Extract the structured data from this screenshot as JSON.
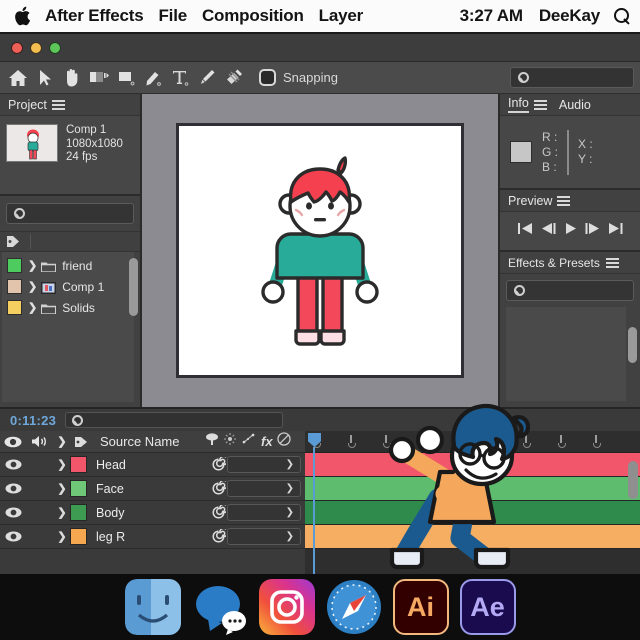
{
  "menubar": {
    "apple_icon": "apple-logo",
    "items": [
      "After Effects",
      "File",
      "Composition",
      "Layer"
    ],
    "time": "3:27 AM",
    "user": "DeeKay",
    "search_icon": "search-icon"
  },
  "window": {
    "controls": [
      "close-button",
      "minimize-button",
      "maximize-button"
    ]
  },
  "toolbar": {
    "tools": [
      "home-icon",
      "selection-arrow-icon",
      "hand-icon",
      "rotation-icon",
      "shape-icon",
      "pen-icon",
      "text-icon",
      "brush-icon",
      "clone-stamp-icon"
    ],
    "snapping_label": "Snapping",
    "snapping_checked": false,
    "search_placeholder": ""
  },
  "project_panel": {
    "title": "Project",
    "menu_icon": "hamburger-icon",
    "comp": {
      "name": "Comp 1",
      "resolution": "1080x1080",
      "framerate": "24 fps"
    },
    "search_placeholder": "",
    "label_column_icon": "tag-icon",
    "assets": [
      {
        "name": "friend",
        "color": "#4ecb5e",
        "type": "folder"
      },
      {
        "name": "Comp 1",
        "color": "#e2c3ac",
        "type": "composition"
      },
      {
        "name": "Solids",
        "color": "#f5cf5f",
        "type": "folder"
      }
    ]
  },
  "comp_viewer": {
    "background": "#8b8b91",
    "canvas_background": "#ffffff",
    "character": {
      "hair": "#f5404f",
      "skin": "#ffffff",
      "sweater": "#29ab9a",
      "pants": "#f2485a",
      "shoes": "#fbdfe4",
      "outline": "#2b2b2b"
    }
  },
  "info_panel": {
    "title": "Info",
    "menu_icon": "hamburger-icon",
    "audio_tab": "Audio",
    "channels": [
      "R :",
      "G :",
      "B :"
    ],
    "coords": [
      "X :",
      "Y :"
    ]
  },
  "preview_panel": {
    "title": "Preview",
    "menu_icon": "hamburger-icon",
    "buttons": [
      "first-frame-button",
      "previous-frame-button",
      "play-button",
      "next-frame-button",
      "last-frame-button"
    ]
  },
  "effects_panel": {
    "title": "Effects & Presets",
    "menu_icon": "hamburger-icon",
    "search_placeholder": ""
  },
  "timeline": {
    "current_time": "0:11:23",
    "search_placeholder": "",
    "columns": {
      "eye_icon": "visibility-eye-icon",
      "audio_icon": "audio-speaker-icon",
      "chevron_icon": "chevron-right-icon",
      "label_icon": "tag-icon",
      "source_name": "Source Name",
      "switches": [
        "shy-icon",
        "quality-icon",
        "effects-icon",
        "fx-icon",
        "adjustment-icon"
      ]
    },
    "layers": [
      {
        "name": "Head",
        "color": "#f2566a",
        "bar_color": "#f2566a",
        "parent": ""
      },
      {
        "name": "Face",
        "color": "#6ec878",
        "bar_color": "#5ebc6e",
        "parent": ""
      },
      {
        "name": "Body",
        "color": "#3e9c52",
        "bar_color": "#2e8b4c",
        "parent": ""
      },
      {
        "name": "leg R",
        "color": "#f5a84f",
        "bar_color": "#f5ae62",
        "parent": ""
      }
    ],
    "playhead_color": "#5b9bd5",
    "ruler_ticks": 9
  },
  "overlay_character": {
    "name": "dabbing-character",
    "hair": "#1b5a8e",
    "shirt": "#f5a85c",
    "pants": "#1b5a8e",
    "shoes": "#e8edf5",
    "face": "#ffffff",
    "outline": "#1a1a1a"
  },
  "dock": {
    "icons": [
      {
        "name": "finder-icon",
        "label": "Finder"
      },
      {
        "name": "messages-icon",
        "label": "Messages"
      },
      {
        "name": "instagram-icon",
        "label": "Instagram"
      },
      {
        "name": "safari-icon",
        "label": "Safari"
      },
      {
        "name": "illustrator-icon",
        "label": "Ai"
      },
      {
        "name": "after-effects-icon",
        "label": "Ae"
      }
    ]
  }
}
